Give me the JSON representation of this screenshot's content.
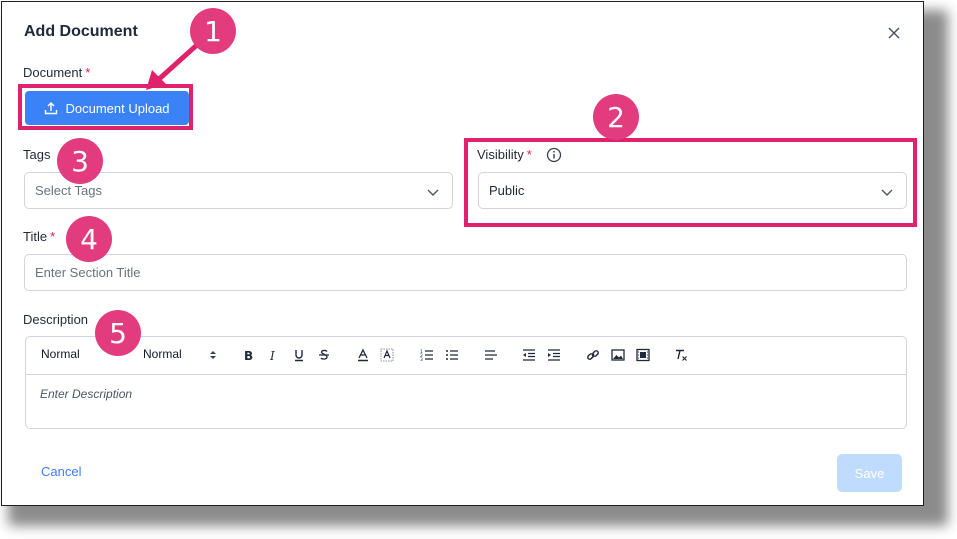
{
  "dialog": {
    "title": "Add Document"
  },
  "document": {
    "label": "Document",
    "required_mark": "*",
    "upload_button": "Document Upload"
  },
  "tags": {
    "label": "Tags",
    "placeholder": "Select Tags"
  },
  "visibility": {
    "label": "Visibility",
    "required_mark": "*",
    "value": "Public"
  },
  "title_field": {
    "label": "Title",
    "required_mark": "*",
    "placeholder": "Enter Section Title"
  },
  "description": {
    "label": "Description",
    "toolbar": {
      "header_select": "Normal",
      "size_select": "Normal"
    },
    "placeholder": "Enter Description"
  },
  "footer": {
    "cancel": "Cancel",
    "save": "Save"
  },
  "annotations": [
    "1",
    "2",
    "3",
    "4",
    "5"
  ],
  "colors": {
    "primary": "#3b82f6",
    "highlight": "#e0226c",
    "badge": "#e23c7e",
    "required": "#e11d48",
    "save_disabled": "#bfdbfe"
  },
  "background_fragment": "A"
}
